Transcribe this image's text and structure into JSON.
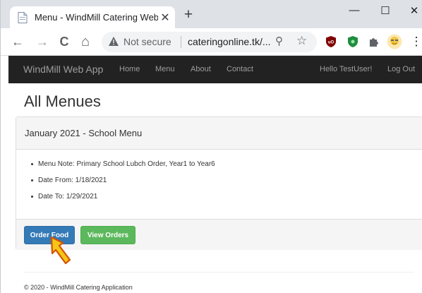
{
  "browser": {
    "tab_title": "Menu - WindMill Catering WebA",
    "tab_close": "✕",
    "new_tab": "+",
    "window_minimize": "—",
    "window_maximize": "☐",
    "window_close": "✕",
    "back": "←",
    "forward": "→",
    "reload": "C",
    "home": "⌂",
    "security_label": "Not secure",
    "url": "cateringonline.tk/...",
    "zoom": "⚲",
    "bookmark": "☆",
    "menu": "⋮"
  },
  "navbar": {
    "brand": "WindMill Web App",
    "links": [
      "Home",
      "Menu",
      "About",
      "Contact"
    ],
    "greeting": "Hello TestUser!",
    "logout": "Log Out"
  },
  "page": {
    "title": "All Menues"
  },
  "panel": {
    "heading": "January 2021 - School Menu",
    "items": [
      "Menu Note: Primary School Lubch Order, Year1 to Year6",
      "Date From: 1/18/2021",
      "Date To: 1/29/2021"
    ],
    "order_button": "Order Food",
    "view_button": "View Orders"
  },
  "footer": {
    "text": "© 2020 - WindMill Catering Application"
  },
  "colors": {
    "navbar_bg": "#222222",
    "primary": "#337ab7",
    "success": "#5cb85c",
    "cursor": "#f5c518"
  },
  "icons": {
    "favicon": "document-icon",
    "warning": "warning-triangle-icon",
    "ext_ublock": "ublock-shield-icon",
    "ext_green": "green-shield-icon",
    "ext_puzzle": "puzzle-icon",
    "avatar": "profile-avatar-icon",
    "pointer": "hand-pointer-icon"
  }
}
